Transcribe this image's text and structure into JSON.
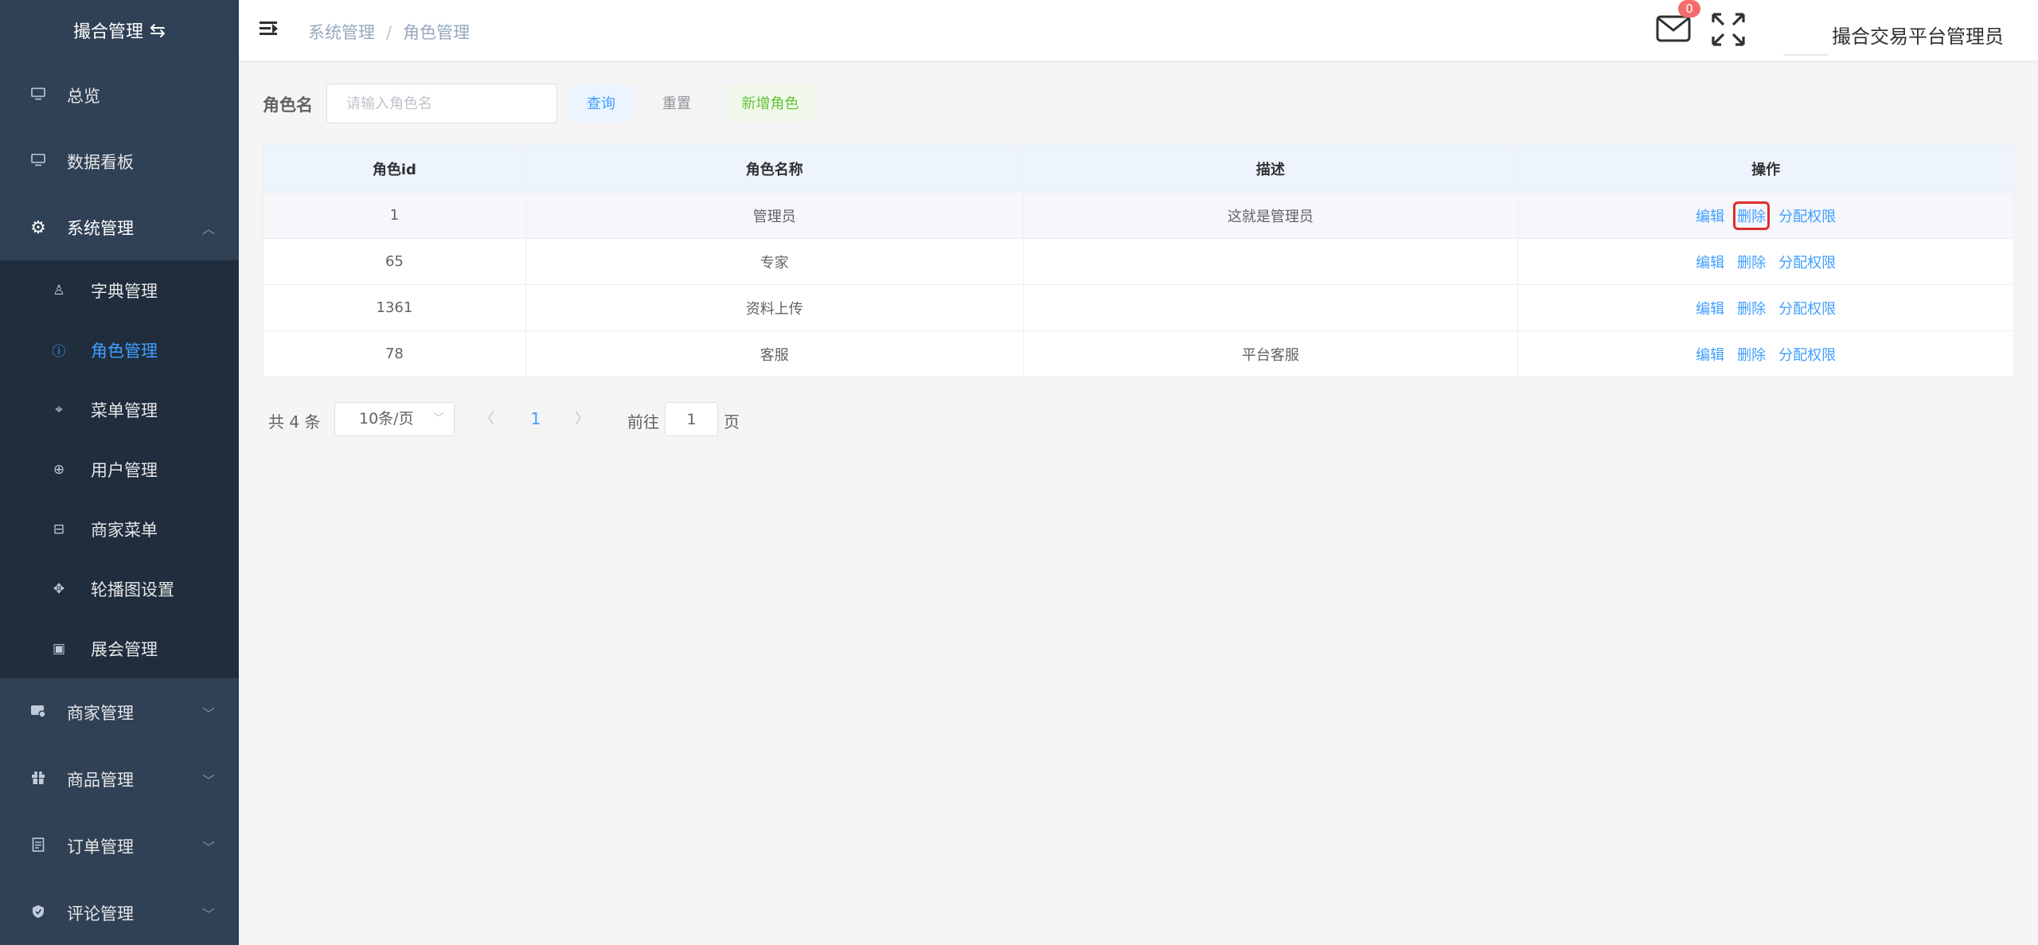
{
  "sidebar": {
    "brand": "撮合管理",
    "items": [
      {
        "label": "总览",
        "icon": "monitor-icon"
      },
      {
        "label": "数据看板",
        "icon": "monitor-icon"
      },
      {
        "label": "系统管理",
        "icon": "gear-icon"
      },
      {
        "label": "商家管理",
        "icon": "shop-icon"
      },
      {
        "label": "商品管理",
        "icon": "gift-icon"
      },
      {
        "label": "订单管理",
        "icon": "document-icon"
      },
      {
        "label": "评论管理",
        "icon": "shield-icon"
      }
    ],
    "submenu": [
      {
        "label": "字典管理",
        "icon": "user-icon"
      },
      {
        "label": "角色管理",
        "icon": "info-icon",
        "active": true
      },
      {
        "label": "菜单管理",
        "icon": "location-icon"
      },
      {
        "label": "用户管理",
        "icon": "zoom-icon"
      },
      {
        "label": "商家菜单",
        "icon": "box-icon"
      },
      {
        "label": "轮播图设置",
        "icon": "rank-icon"
      },
      {
        "label": "展会管理",
        "icon": "picture-icon"
      }
    ]
  },
  "header": {
    "breadcrumb": [
      "系统管理",
      "角色管理"
    ],
    "separator": "/",
    "badge_count": "0",
    "username": "撮合交易平台管理员"
  },
  "search": {
    "label": "角色名",
    "placeholder": "请输入角色名",
    "query_label": "查询",
    "reset_label": "重置",
    "add_label": "新增角色"
  },
  "table": {
    "columns": [
      "角色id",
      "角色名称",
      "描述",
      "操作"
    ],
    "rows": [
      {
        "id": "1",
        "name": "管理员",
        "desc": "这就是管理员"
      },
      {
        "id": "65",
        "name": "专家",
        "desc": ""
      },
      {
        "id": "1361",
        "name": "资料上传",
        "desc": ""
      },
      {
        "id": "78",
        "name": "客服",
        "desc": "平台客服"
      }
    ],
    "actions": {
      "edit": "编辑",
      "delete": "删除",
      "perm": "分配权限"
    }
  },
  "pagination": {
    "total": "共 4 条",
    "page_size": "10条/页",
    "current": "1",
    "goto": "前往",
    "jump_value": "1",
    "page_suffix": "页"
  },
  "colors": {
    "sidebar_bg": "#304156",
    "submenu_bg": "#1f2d3d",
    "accent": "#409eff",
    "highlight_box": "#e12d2d"
  }
}
